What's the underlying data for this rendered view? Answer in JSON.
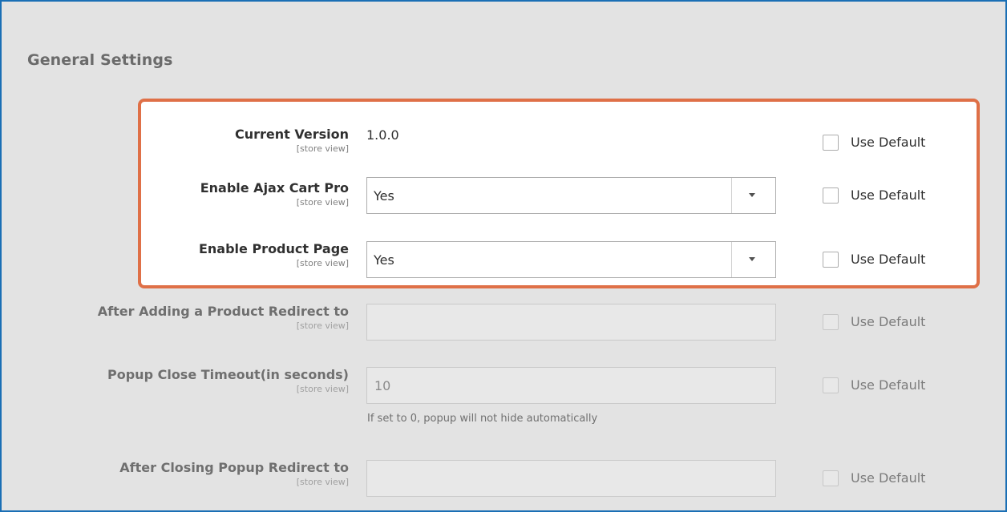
{
  "section": {
    "title": "General Settings"
  },
  "scope_label": "[store view]",
  "use_default_label": "Use Default",
  "fields": {
    "current_version": {
      "label": "Current Version",
      "value": "1.0.0"
    },
    "enable_ajax_cart_pro": {
      "label": "Enable Ajax Cart Pro",
      "value": "Yes"
    },
    "enable_product_page": {
      "label": "Enable Product Page",
      "value": "Yes"
    },
    "after_adding_redirect": {
      "label": "After Adding a Product Redirect to",
      "value": ""
    },
    "popup_close_timeout": {
      "label": "Popup Close Timeout(in seconds)",
      "value": "10",
      "note": "If set to 0, popup will not hide automatically"
    },
    "after_closing_redirect": {
      "label": "After Closing Popup Redirect to",
      "value": ""
    }
  },
  "colors": {
    "highlight_border": "#df7047",
    "frame_border": "#1a6fb5",
    "page_background": "#e3e3e3"
  }
}
